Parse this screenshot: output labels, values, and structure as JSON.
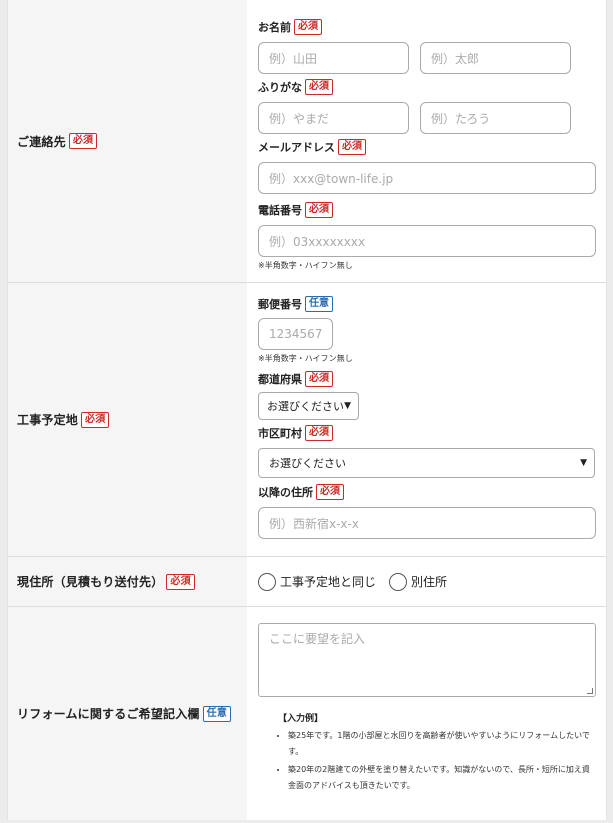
{
  "badges": {
    "required": "必須",
    "optional": "任意"
  },
  "contact": {
    "label": "ご連絡先",
    "name": {
      "title": "お名前",
      "last_placeholder": "例）山田",
      "first_placeholder": "例）太郎"
    },
    "kana": {
      "title": "ふりがな",
      "last_placeholder": "例）やまだ",
      "first_placeholder": "例）たろう"
    },
    "email": {
      "title": "メールアドレス",
      "placeholder": "例）xxx@town-life.jp"
    },
    "phone": {
      "title": "電話番号",
      "placeholder": "例）03xxxxxxxx",
      "note": "※半角数字・ハイフン無し"
    }
  },
  "site": {
    "label": "工事予定地",
    "postal": {
      "title": "郵便番号",
      "placeholder": "1234567",
      "note": "※半角数字・ハイフン無し"
    },
    "prefecture": {
      "title": "都道府県",
      "selected": "お選びください"
    },
    "city": {
      "title": "市区町村",
      "selected": "お選びください"
    },
    "address": {
      "title": "以降の住所",
      "placeholder": "例）西新宿x-x-x"
    }
  },
  "current_address": {
    "label": "現住所（見積もり送付先）",
    "option_same": "工事予定地と同じ",
    "option_other": "別住所"
  },
  "request": {
    "label": "リフォームに関するご希望記入欄",
    "placeholder": "ここに要望を記入",
    "example_title": "【入力例】",
    "examples": [
      "築25年です。1階の小部屋と水回りを高齢者が使いやすいようにリフォームしたいです。",
      "築20年の2階建ての外壁を塗り替えたいです。知識がないので、長所・短所に加え資金面のアドバイスも頂きたいです。"
    ]
  },
  "colors": {
    "required": "#cc2a2a",
    "optional": "#2b6cb0"
  }
}
